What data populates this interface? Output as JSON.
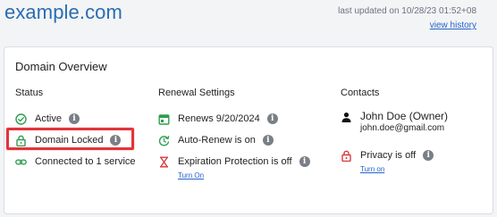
{
  "header": {
    "title": "example.com",
    "last_updated": "last updated on 10/28/23 01:52+08",
    "view_history": "view history"
  },
  "overview": {
    "title": "Domain Overview",
    "status": {
      "header": "Status",
      "items": [
        {
          "label": "Active",
          "icon": "check-circle-icon",
          "has_info": true
        },
        {
          "label": "Domain Locked",
          "icon": "lock-icon",
          "has_info": true,
          "highlighted": true
        },
        {
          "label": "Connected to 1 service",
          "icon": "link-icon",
          "has_info": false
        }
      ]
    },
    "renewal": {
      "header": "Renewal Settings",
      "items": [
        {
          "label": "Renews 9/20/2024",
          "icon": "calendar-icon",
          "has_info": true
        },
        {
          "label": "Auto-Renew is on",
          "icon": "auto-renew-icon",
          "has_info": true
        },
        {
          "label": "Expiration Protection is off",
          "icon": "hourglass-icon",
          "has_info": true,
          "link": "Turn On"
        }
      ]
    },
    "contacts": {
      "header": "Contacts",
      "owner_name": "John Doe (Owner)",
      "owner_email": "john.doe@gmail.com",
      "privacy_label": "Privacy is off",
      "privacy_link": "Turn on"
    }
  },
  "colors": {
    "green": "#2e9e4f",
    "red": "#d63b3b",
    "link": "#2563c9",
    "highlight": "#e0353a"
  }
}
